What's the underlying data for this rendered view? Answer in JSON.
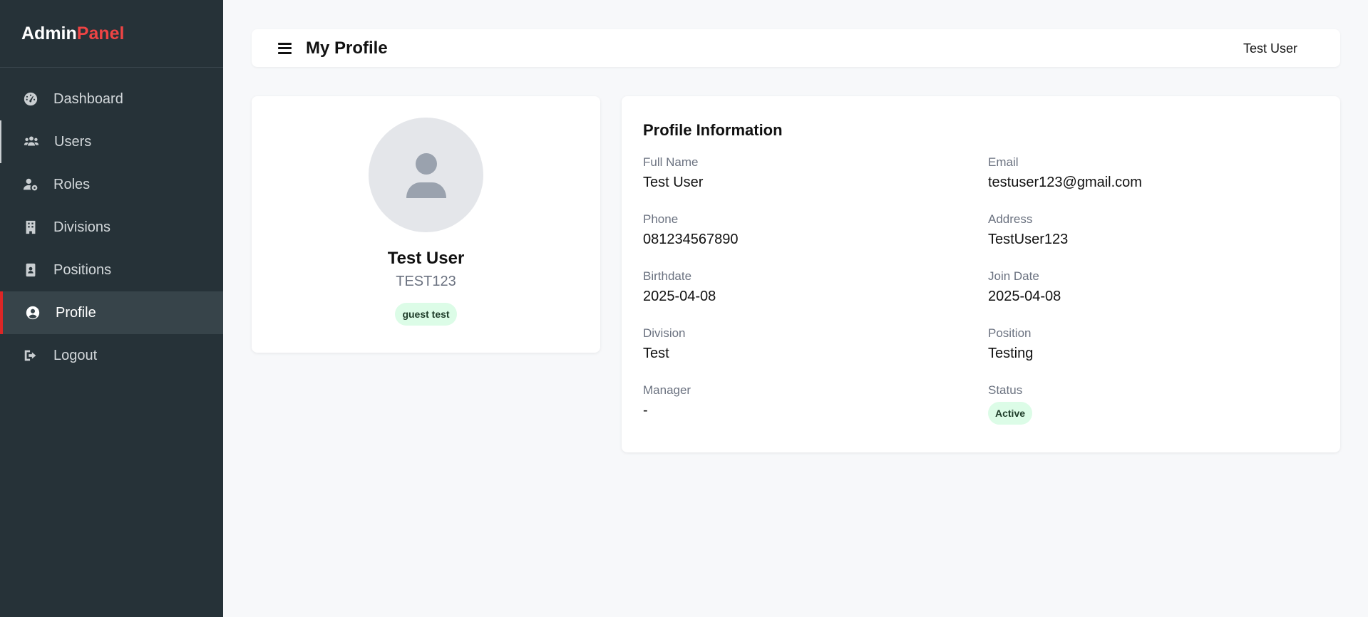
{
  "brand": {
    "part1": "Admin",
    "part2": "Panel"
  },
  "sidebar": {
    "items": [
      {
        "label": "Dashboard",
        "icon": "gauge-icon"
      },
      {
        "label": "Users",
        "icon": "users-icon"
      },
      {
        "label": "Roles",
        "icon": "user-gear-icon"
      },
      {
        "label": "Divisions",
        "icon": "building-icon"
      },
      {
        "label": "Positions",
        "icon": "id-badge-icon"
      },
      {
        "label": "Profile",
        "icon": "user-circle-icon"
      },
      {
        "label": "Logout",
        "icon": "logout-icon"
      }
    ],
    "active": "Profile"
  },
  "header": {
    "title": "My Profile",
    "user": "Test User"
  },
  "profile": {
    "name": "Test User",
    "code": "TEST123",
    "role": "guest test"
  },
  "info": {
    "title": "Profile Information",
    "fields": [
      {
        "label": "Full Name",
        "value": "Test User"
      },
      {
        "label": "Email",
        "value": "testuser123@gmail.com"
      },
      {
        "label": "Phone",
        "value": "081234567890"
      },
      {
        "label": "Address",
        "value": "TestUser123"
      },
      {
        "label": "Birthdate",
        "value": "2025-04-08"
      },
      {
        "label": "Join Date",
        "value": "2025-04-08"
      },
      {
        "label": "Division",
        "value": "Test"
      },
      {
        "label": "Position",
        "value": "Testing"
      },
      {
        "label": "Manager",
        "value": "-"
      },
      {
        "label": "Status",
        "value": "Active"
      }
    ]
  },
  "colors": {
    "sidebar_bg": "#263238",
    "accent": "#ef4444",
    "badge_bg": "#dcfce7"
  }
}
